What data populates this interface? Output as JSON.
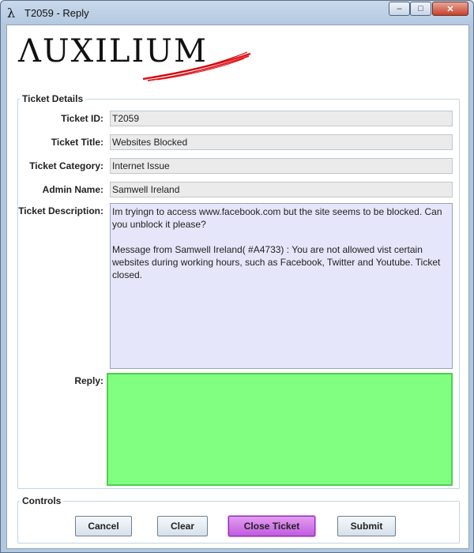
{
  "window": {
    "title": "T2059 - Reply",
    "app_icon": "lambda-icon",
    "min_glyph": "–",
    "max_glyph": "□",
    "close_glyph": "✕"
  },
  "logo": {
    "text": "ΛUXILIUM"
  },
  "ticket_details": {
    "group_label": "Ticket Details",
    "ticket_id_label": "Ticket ID:",
    "ticket_id": "T2059",
    "ticket_title_label": "Ticket Title:",
    "ticket_title": "Websites Blocked",
    "ticket_category_label": "Ticket Category:",
    "ticket_category": "Internet Issue",
    "admin_name_label": "Admin Name:",
    "admin_name": "Samwell Ireland",
    "description_label": "Ticket Description:",
    "description": "Im tryingn to access www.facebook.com but the site seems to be blocked. Can you unblock it please?\n\nMessage from Samwell Ireland( #A4733) : You are not allowed vist certain websites during working hours, such as Facebook, Twitter and Youtube. Ticket closed.",
    "reply_label": "Reply:",
    "reply_value": ""
  },
  "controls": {
    "group_label": "Controls",
    "cancel_label": "Cancel",
    "clear_label": "Clear",
    "close_ticket_label": "Close Ticket",
    "submit_label": "Submit"
  },
  "colors": {
    "reply_bg": "#80ff80",
    "description_bg": "#e6e6fa",
    "close_ticket_bg": "#c15de0",
    "logo_swoosh": "#e0141c"
  }
}
